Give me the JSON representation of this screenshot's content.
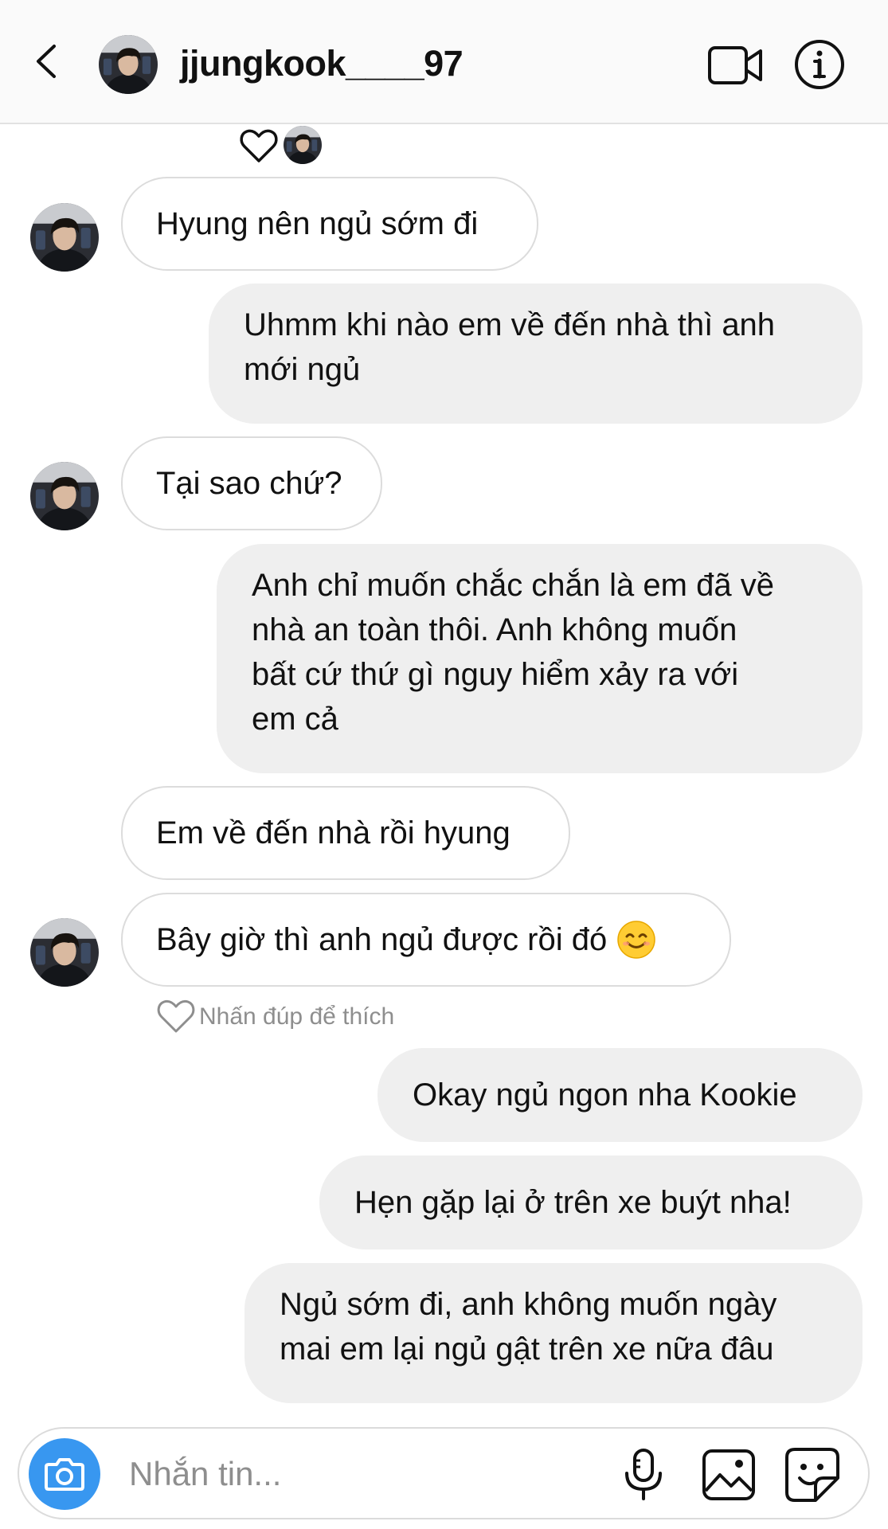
{
  "header": {
    "username": "jjungkook____97",
    "back_icon": "chevron-left-icon",
    "video_icon": "video-camera-icon",
    "info_icon": "info-icon"
  },
  "thread": {
    "reaction_icons": [
      "heart-icon",
      "avatar"
    ],
    "messages": [
      {
        "direction": "incoming",
        "lines": [
          "Hyung nên ngủ sớm đi"
        ]
      },
      {
        "direction": "outgoing",
        "lines": [
          "Uhmm khi nào em về đến nhà thì anh",
          "mới ngủ"
        ]
      },
      {
        "direction": "incoming",
        "lines": [
          "Tại sao chứ?"
        ]
      },
      {
        "direction": "outgoing",
        "lines": [
          "Anh chỉ muốn chắc chắn là em đã về",
          "nhà an toàn thôi. Anh không muốn",
          "bất cứ thứ gì nguy hiểm xảy ra với",
          "em cả"
        ]
      },
      {
        "direction": "incoming",
        "lines": [
          "Em về đến nhà rồi hyung"
        ]
      },
      {
        "direction": "incoming",
        "lines": [
          "Bây giờ thì anh ngủ được rồi đó"
        ],
        "emoji": "smiling-face-emoji"
      },
      {
        "direction": "outgoing",
        "lines": [
          "Okay ngủ ngon nha Kookie"
        ]
      },
      {
        "direction": "outgoing",
        "lines": [
          "Hẹn gặp lại ở trên xe buýt nha!"
        ]
      },
      {
        "direction": "outgoing",
        "lines": [
          "Ngủ sớm đi, anh không muốn ngày",
          "mai em lại ngủ gật trên xe nữa đâu"
        ]
      }
    ],
    "like_hint": "Nhấn đúp để thích"
  },
  "composer": {
    "placeholder": "Nhắn tin...",
    "icons": [
      "camera-icon",
      "microphone-icon",
      "gallery-icon",
      "sticker-icon"
    ]
  },
  "colors": {
    "accent_blue": "#3897f0",
    "outgoing_bubble": "#efefef",
    "incoming_border": "#dcdcdc",
    "hint_gray": "#8e8e8e"
  }
}
